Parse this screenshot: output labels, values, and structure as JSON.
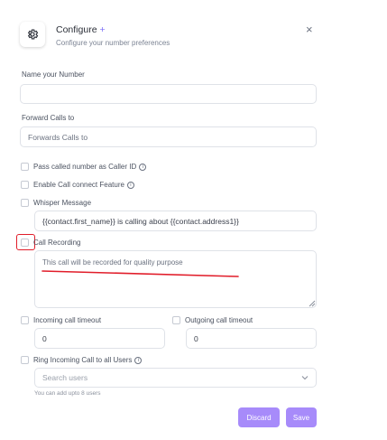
{
  "header": {
    "title": "Configure",
    "title_suffix": "+",
    "subtitle": "Configure your number preferences",
    "close": "×"
  },
  "form": {
    "name_label": "Name your Number",
    "name_value": "",
    "forward_label": "Forward Calls to",
    "forward_placeholder": "Forwards Calls to",
    "pass_caller_id_label": "Pass called number as Caller ID",
    "call_connect_label": "Enable Call connect Feature",
    "whisper_label": "Whisper Message",
    "whisper_value": "{{contact.first_name}} is calling about {{contact.address1}}",
    "call_recording_label": "Call Recording",
    "call_recording_text": "This call will be recorded for quality purpose",
    "incoming_timeout_label": "Incoming call timeout",
    "incoming_timeout_value": "0",
    "outgoing_timeout_label": "Outgoing call timeout",
    "outgoing_timeout_value": "0",
    "ring_all_label": "Ring Incoming Call to all Users",
    "search_users_placeholder": "Search users",
    "helper_text": "You can add upto 8 users"
  },
  "actions": {
    "discard": "Discard",
    "save": "Save"
  },
  "colors": {
    "accent": "#a78bfa",
    "annotation": "#e11d2a"
  }
}
